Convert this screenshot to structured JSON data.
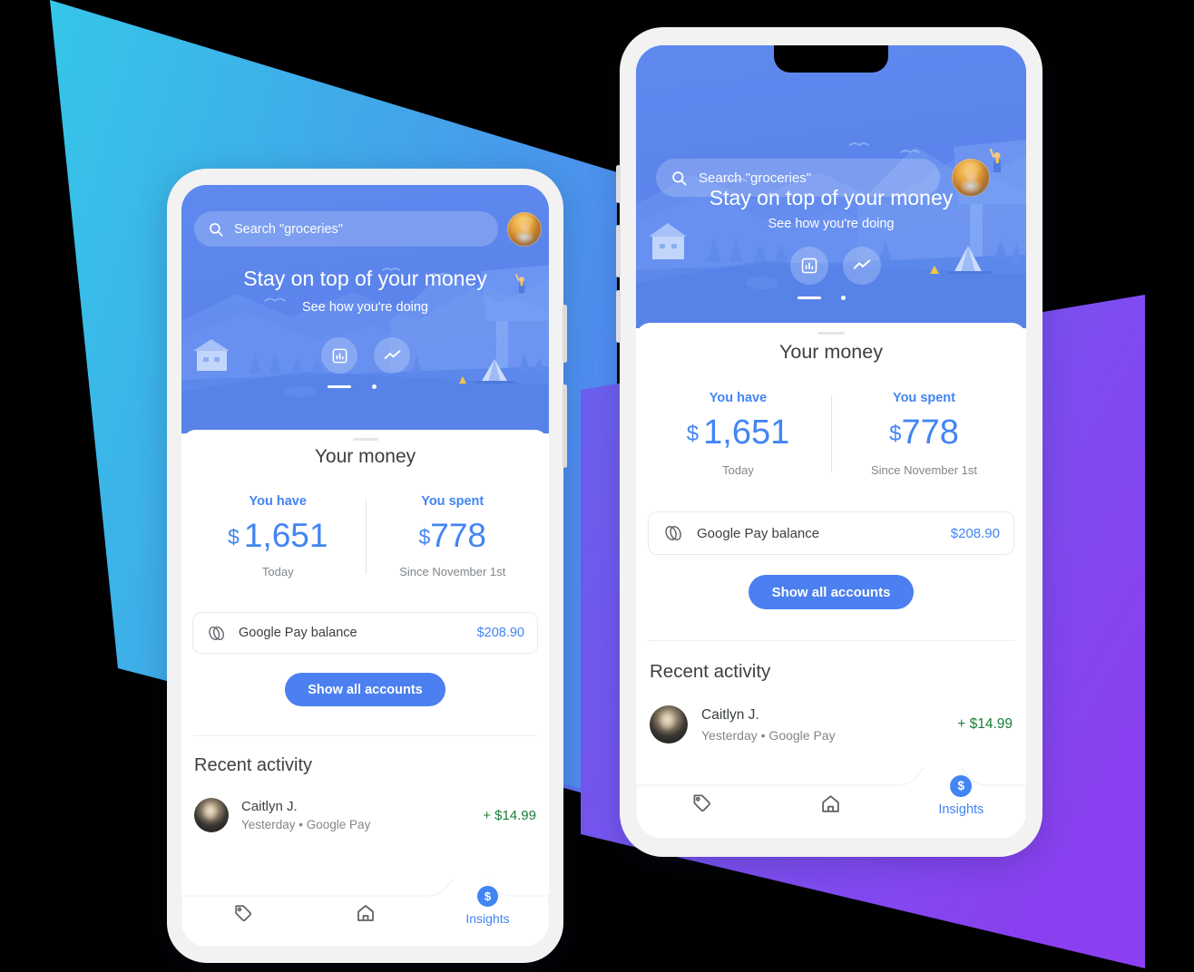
{
  "background": {
    "left_shape_color_start": "#35c6e8",
    "left_shape_color_end": "#4f8df0",
    "right_shape_color_start": "#6a63ef",
    "right_shape_color_end": "#8b3ff0",
    "mid_shape_color": "#4f86f2"
  },
  "phones": [
    {
      "id": "left-phone",
      "hero": {
        "search": {
          "placeholder": "Search \"groceries\"",
          "icon": "search-icon"
        },
        "avatar": "user-avatar",
        "title": "Stay on top of your money",
        "subtitle": "See how you're doing",
        "toggles": [
          {
            "icon": "bar-chart-icon",
            "selected": true
          },
          {
            "icon": "trend-line-icon",
            "selected": false
          }
        ]
      },
      "sheet": {
        "title": "Your money",
        "stats": [
          {
            "label": "You have",
            "currency": "$",
            "value": "1,651",
            "caption": "Today"
          },
          {
            "label": "You spent",
            "currency": "$",
            "value": "778",
            "caption": "Since November 1st"
          }
        ],
        "account": {
          "icon": "google-pay-icon",
          "name": "Google Pay balance",
          "amount": "$208.90"
        },
        "show_all_accounts_label": "Show all accounts",
        "recent_activity_title": "Recent activity",
        "activities": [
          {
            "avatar": "contact-avatar",
            "name": "Caitlyn J.",
            "meta": "Yesterday • Google Pay",
            "amount": "+ $14.99"
          }
        ]
      },
      "bottom_nav": [
        {
          "icon": "tag-icon",
          "label": "",
          "active": false
        },
        {
          "icon": "home-icon",
          "label": "",
          "active": false
        },
        {
          "icon": "dollar-badge-icon",
          "badge": "$",
          "label": "Insights",
          "active": true
        }
      ]
    },
    {
      "id": "right-phone",
      "hero": {
        "search": {
          "placeholder": "Search \"groceries\"",
          "icon": "search-icon"
        },
        "avatar": "user-avatar",
        "title": "Stay on top of your money",
        "subtitle": "See how you're doing",
        "toggles": [
          {
            "icon": "bar-chart-icon",
            "selected": true
          },
          {
            "icon": "trend-line-icon",
            "selected": false
          }
        ]
      },
      "sheet": {
        "title": "Your money",
        "stats": [
          {
            "label": "You have",
            "currency": "$",
            "value": "1,651",
            "caption": "Today"
          },
          {
            "label": "You spent",
            "currency": "$",
            "value": "778",
            "caption": "Since November 1st"
          }
        ],
        "account": {
          "icon": "google-pay-icon",
          "name": "Google Pay balance",
          "amount": "$208.90"
        },
        "show_all_accounts_label": "Show all accounts",
        "recent_activity_title": "Recent activity",
        "activities": [
          {
            "avatar": "contact-avatar",
            "name": "Caitlyn J.",
            "meta": "Yesterday • Google Pay",
            "amount": "+ $14.99"
          }
        ]
      },
      "bottom_nav": [
        {
          "icon": "tag-icon",
          "label": "",
          "active": false
        },
        {
          "icon": "home-icon",
          "label": "",
          "active": false
        },
        {
          "icon": "dollar-badge-icon",
          "badge": "$",
          "label": "Insights",
          "active": true
        }
      ]
    }
  ],
  "colors": {
    "accent_blue": "#4285f4",
    "button_blue": "#4c7ff0",
    "positive_green": "#188038",
    "text_primary": "#3c4043",
    "text_secondary": "#80868b"
  }
}
